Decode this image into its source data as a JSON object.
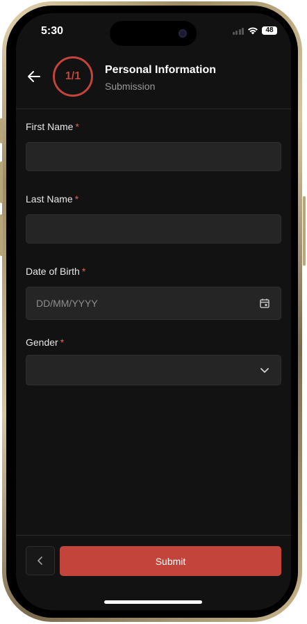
{
  "status_bar": {
    "time": "5:30",
    "battery_level": "48",
    "icons": [
      "signal-bars-icon",
      "wifi-icon",
      "battery-icon"
    ]
  },
  "header": {
    "back_icon": "arrow-left-icon",
    "step_counter": "1/1",
    "title": "Personal Information",
    "subtitle": "Submission"
  },
  "form": {
    "required_marker": "*",
    "fields": [
      {
        "label": "First Name",
        "value": "",
        "placeholder": ""
      },
      {
        "label": "Last Name",
        "value": "",
        "placeholder": ""
      },
      {
        "label": "Date of Birth",
        "value": "",
        "placeholder": "DD/MM/YYYY",
        "icon": "calendar-icon"
      },
      {
        "label": "Gender",
        "value": "",
        "placeholder": "",
        "icon": "chevron-down-icon"
      }
    ]
  },
  "footer": {
    "prev_icon": "chevron-left-icon",
    "submit_label": "Submit"
  },
  "colors": {
    "accent": "#c2443b",
    "background": "#121212",
    "input_bg": "#252525",
    "required": "#e25f55"
  }
}
